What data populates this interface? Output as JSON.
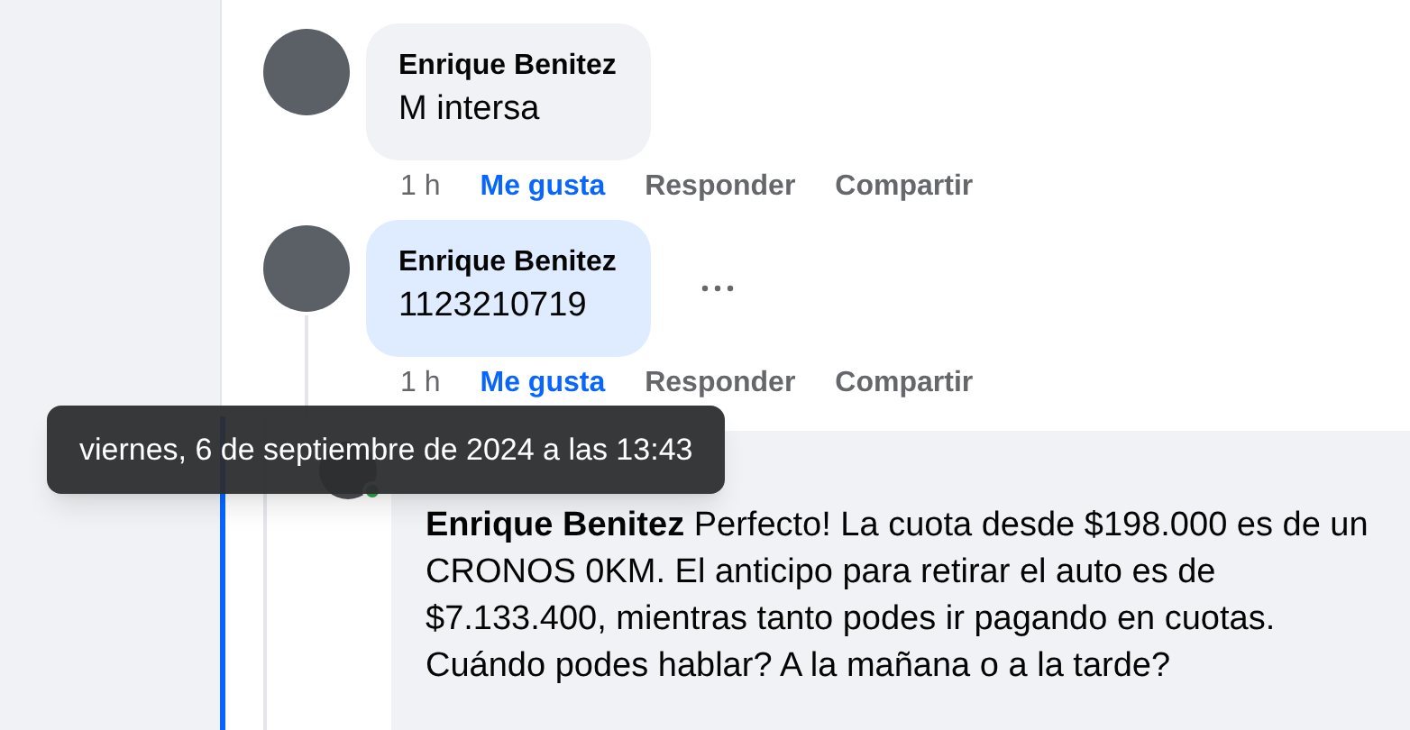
{
  "comments": [
    {
      "author": "Enrique Benitez",
      "text": "M intersa",
      "highlighted": false,
      "show_more": false,
      "time": "1 h",
      "like": "Me gusta",
      "reply": "Responder",
      "share": "Compartir"
    },
    {
      "author": "Enrique Benitez",
      "text": "1123210719",
      "highlighted": true,
      "show_more": true,
      "time": "1 h",
      "like": "Me gusta",
      "reply": "Responder",
      "share": "Compartir"
    }
  ],
  "reply": {
    "online": true,
    "text": "**Enrique Benitez** Perfecto! La cuota desde $198.000 es de un CRONOS 0KM. El anticipo para retirar el auto es de $7.133.400, mientras tanto podes ir pagando en cuotas. Cuándo podes hablar? A la mañana o a la tarde?"
  },
  "tooltip": "viernes, 6 de septiembre de 2024 a las 13:43"
}
